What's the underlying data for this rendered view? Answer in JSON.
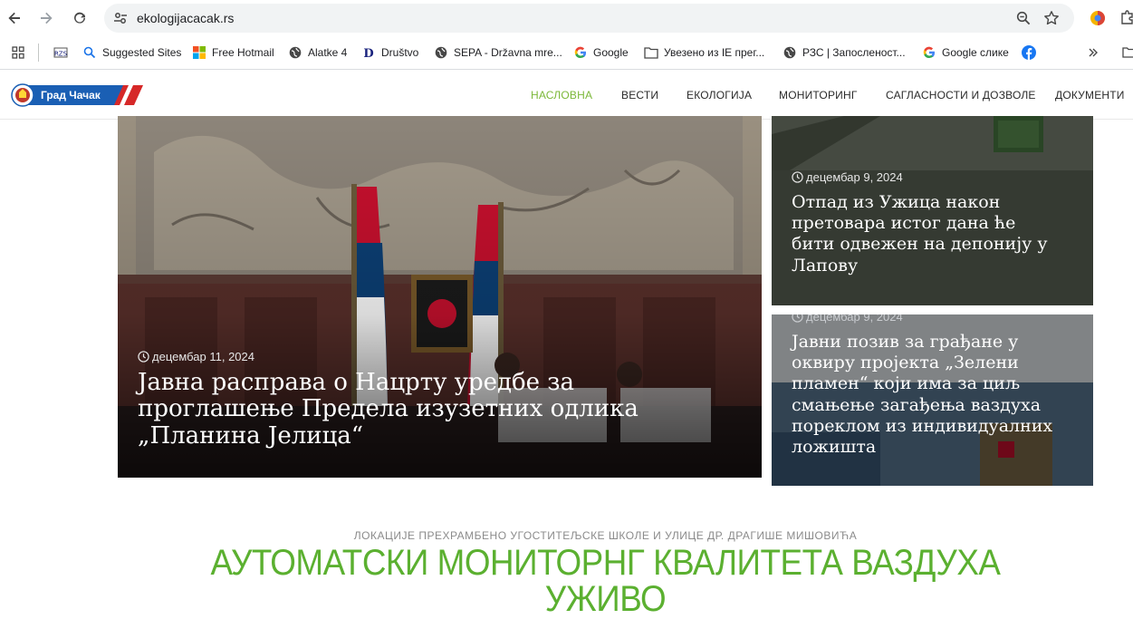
{
  "browser": {
    "url": "ekologijacacak.rs"
  },
  "bookmarks": [
    {
      "label": "",
      "icon": "site-logo-icon"
    },
    {
      "label": "Suggested Sites",
      "icon": "search-icon"
    },
    {
      "label": "Free Hotmail",
      "icon": "windows-icon"
    },
    {
      "label": "Alatke 4",
      "icon": "globe-icon"
    },
    {
      "label": "Društvo",
      "icon": "d-logo-icon"
    },
    {
      "label": "SEPA - Državna mre...",
      "icon": "globe-icon"
    },
    {
      "label": "Google",
      "icon": "google-icon"
    },
    {
      "label": "Увезено из IE прег...",
      "icon": "folder-icon"
    },
    {
      "label": "РЗС | Запосленост...",
      "icon": "globe-icon"
    },
    {
      "label": "Google слике",
      "icon": "google-icon"
    },
    {
      "label": "",
      "icon": "facebook-icon"
    }
  ],
  "site": {
    "logo_text": "Град Чачак",
    "menu": [
      {
        "label": "НАСЛОВНА",
        "active": true
      },
      {
        "label": "ВЕСТИ",
        "active": false
      },
      {
        "label": "ЕКОЛОГИЈА",
        "active": false
      },
      {
        "label": "МОНИТОРИНГ",
        "active": false
      },
      {
        "label": "САГЛАСНОСТИ И ДОЗВОЛЕ",
        "active": false
      },
      {
        "label": "ДОКУМЕНТИ",
        "active": false
      }
    ]
  },
  "hero": {
    "main": {
      "date": "децембар 11, 2024",
      "title_lines": [
        "Јавна расправа о Нацрту уредбе за",
        "проглашење Предела изузетних одлика",
        "„Планина Јелица“"
      ]
    },
    "card1": {
      "date": "децембар 9, 2024",
      "title_lines": [
        "Отпад из Ужица након",
        "претовара истог дана ће",
        "бити одвежен на депонију у",
        "Лапову"
      ]
    },
    "card2": {
      "date": "децембар 9, 2024",
      "title_lines": [
        "Јавни позив за грађане у",
        "оквиру пројекта „Зелени",
        "пламен“ који има за циљ",
        "смањење загађења ваздуха",
        "пореклом из индивидуалних",
        "ложишта"
      ]
    }
  },
  "monitoring": {
    "kicker": "ЛОКАЦИЈЕ ПРЕХРАМБЕНО УГОСТИТЕЉСКЕ ШКОЛЕ И УЛИЦЕ ДР. ДРАГИШЕ МИШОВИЋА",
    "title_line1": "АУТОМАТСКИ МОНИТОРНГ КВАЛИТЕТА ВАЗДУХА",
    "title_line2": "УЖИВО"
  },
  "colors": {
    "menu_active": "#7cb83a",
    "title_green": "#5bb030"
  }
}
